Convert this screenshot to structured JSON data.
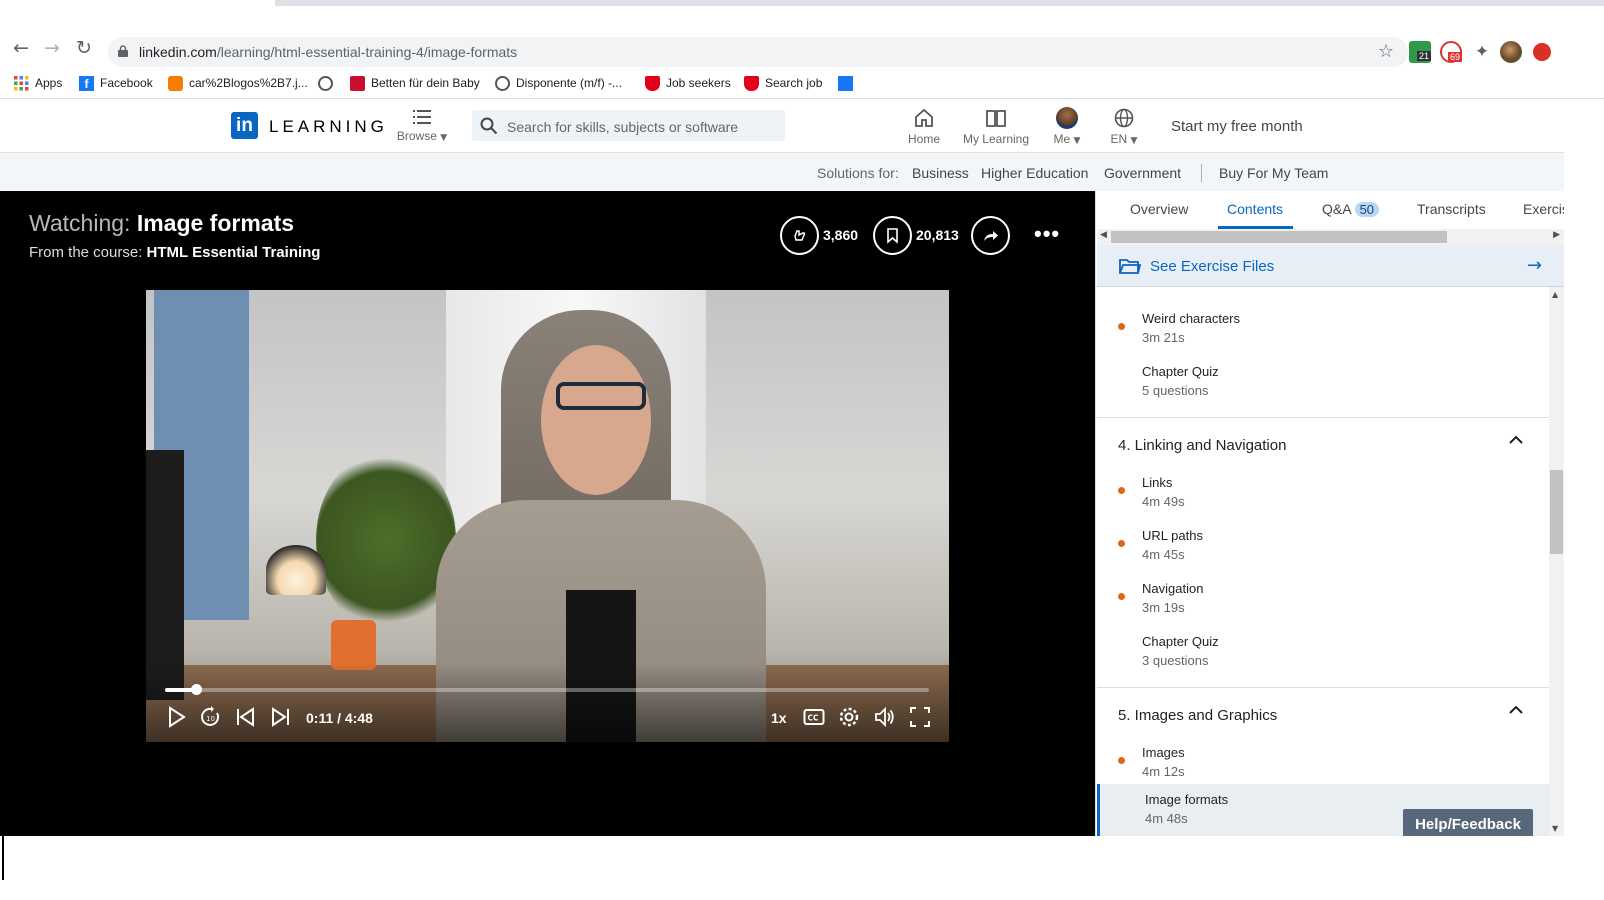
{
  "browser": {
    "url_host": "linkedin.com",
    "url_path": "/learning/html-essential-training-4/image-formats",
    "bookmarks": [
      {
        "label": "Apps"
      },
      {
        "label": "Facebook"
      },
      {
        "label": "car%2Blogos%2B7.j..."
      },
      {
        "label": ""
      },
      {
        "label": "Betten für dein Baby"
      },
      {
        "label": "Disponente (m/f) -..."
      },
      {
        "label": "Job seekers"
      },
      {
        "label": "Search job"
      },
      {
        "label": ""
      }
    ],
    "ext_badges": [
      "21",
      "69"
    ]
  },
  "header": {
    "logo_mark": "in",
    "logo_text": "LEARNING",
    "browse_label": "Browse",
    "search_placeholder": "Search for skills, subjects or software",
    "nav": [
      {
        "label": "Home"
      },
      {
        "label": "My Learning"
      },
      {
        "label": "Me"
      },
      {
        "label": "EN"
      }
    ],
    "cta": "Start my free month"
  },
  "solutions": {
    "prefix": "Solutions for:",
    "items": [
      "Business",
      "Higher Education",
      "Government"
    ],
    "team": "Buy For My Team"
  },
  "player": {
    "watching_prefix": "Watching:",
    "video_title": "Image formats",
    "from_prefix": "From the course:",
    "course_title": "HTML Essential Training",
    "likes": "3,860",
    "saves": "20,813",
    "time": "0:11 / 4:48",
    "speed": "1x",
    "progress_fraction": 0.04
  },
  "panel": {
    "tabs": [
      {
        "label": "Overview"
      },
      {
        "label": "Contents"
      },
      {
        "label": "Q&A",
        "badge": "50"
      },
      {
        "label": "Transcripts"
      },
      {
        "label": "Exercis"
      }
    ],
    "exercise_files": "See Exercise Files",
    "toc": [
      {
        "kind": "item",
        "title": "Weird characters",
        "detail": "3m 21s",
        "watched": true
      },
      {
        "kind": "item",
        "title": "Chapter Quiz",
        "detail": "5 questions",
        "watched": false
      },
      {
        "kind": "section",
        "title": "4. Linking and Navigation"
      },
      {
        "kind": "item",
        "title": "Links",
        "detail": "4m 49s",
        "watched": true
      },
      {
        "kind": "item",
        "title": "URL paths",
        "detail": "4m 45s",
        "watched": true
      },
      {
        "kind": "item",
        "title": "Navigation",
        "detail": "3m 19s",
        "watched": true
      },
      {
        "kind": "item",
        "title": "Chapter Quiz",
        "detail": "3 questions",
        "watched": false
      },
      {
        "kind": "section",
        "title": "5. Images and Graphics"
      },
      {
        "kind": "item",
        "title": "Images",
        "detail": "4m 12s",
        "watched": true
      },
      {
        "kind": "item",
        "title": "Image formats",
        "detail": "4m 48s",
        "watched": false,
        "current": true
      }
    ]
  },
  "help_label": "Help/Feedback",
  "colors": {
    "brand": "#0a66c2",
    "watched_dot": "#e06714",
    "player_bg": "#000000"
  }
}
